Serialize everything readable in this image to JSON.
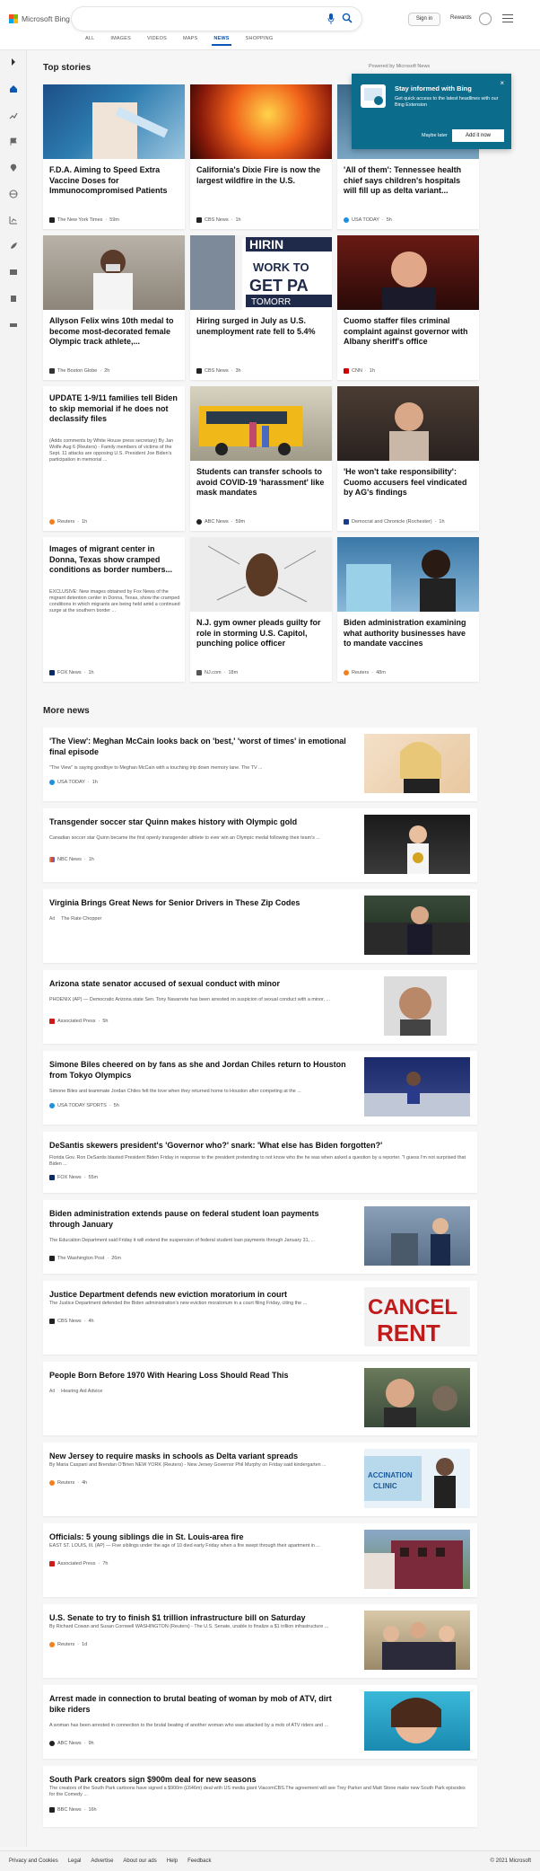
{
  "header": {
    "logo_text": "Microsoft Bing",
    "signin": "Sign in",
    "rewards": "Rewards",
    "tabs": [
      "ALL",
      "IMAGES",
      "VIDEOS",
      "MAPS",
      "NEWS",
      "SHOPPING"
    ],
    "active_tab": "NEWS"
  },
  "top_stories": {
    "title": "Top stories",
    "powered": "Powered by Microsoft News",
    "cards": [
      {
        "title": "F.D.A. Aiming to Speed Extra Vaccine Doses for Immunocompromised Patients",
        "source": "The New York Times",
        "time": "59m"
      },
      {
        "title": "California's Dixie Fire is now the largest wildfire in the U.S.",
        "source": "CBS News",
        "time": "1h"
      },
      {
        "title": "'All of them': Tennessee health chief says children's hospitals will fill up as delta variant...",
        "source": "USA TODAY",
        "time": "5h"
      },
      {
        "title": "Allyson Felix wins 10th medal to become most-decorated female Olympic track athlete,...",
        "source": "The Boston Globe",
        "time": "2h"
      },
      {
        "title": "Hiring surged in July as U.S. unemployment rate fell to 5.4%",
        "source": "CBS News",
        "time": "3h"
      },
      {
        "title": "Cuomo staffer files criminal complaint against governor with Albany sheriff's office",
        "source": "CNN",
        "time": "1h"
      },
      {
        "title": "UPDATE 1-9/11 families tell Biden to skip memorial if he does not declassify files",
        "desc": "(Adds comments by White House press secretary) By Jan Wolfe Aug 6 (Reuters) - Family members of victims of the Sept. 11 attacks are opposing U.S. President Joe Biden's participation in memorial ...",
        "source": "Reuters",
        "time": "1h"
      },
      {
        "title": "Students can transfer schools to avoid COVID-19 'harassment' like mask mandates",
        "source": "ABC News",
        "time": "59m"
      },
      {
        "title": "'He won't take responsibility': Cuomo accusers feel vindicated by AG's findings",
        "source": "Democrat and Chronicle (Rochester)",
        "time": "1h"
      },
      {
        "title": "Images of migrant center in Donna, Texas show cramped conditions as border numbers...",
        "desc": "EXCLUSIVE: New images obtained by Fox News of the migrant detention center in Donna, Texas, show the cramped conditions in which migrants are being held amid a continued surge at the southern border ...",
        "source": "FOX News",
        "time": "1h"
      },
      {
        "title": "N.J. gym owner pleads guilty for role in storming U.S. Capitol, punching police officer",
        "source": "NJ.com",
        "time": "18m"
      },
      {
        "title": "Biden administration examining what authority businesses have to mandate vaccines",
        "source": "Reuters",
        "time": "48m"
      }
    ]
  },
  "popup": {
    "title": "Stay informed with Bing",
    "text": "Get quick access to the latest headlines with our Bing Extension",
    "later": "Maybe later",
    "add": "Add it now",
    "close": "×"
  },
  "more_news": {
    "title": "More news",
    "items": [
      {
        "title": "'The View': Meghan McCain looks back on 'best,' 'worst of times' in emotional final episode",
        "desc": "\"The View\" is saying goodbye to Meghan McCain with a touching trip down memory lane. The TV ...",
        "source": "USA TODAY",
        "time": "1h"
      },
      {
        "title": "Transgender soccer star Quinn makes history with Olympic gold",
        "desc": "Canadian soccer star Quinn became the first openly transgender athlete to ever win an Olympic medal following their team's ...",
        "source": "NBC News",
        "time": "1h"
      },
      {
        "title": "Virginia Brings Great News for Senior Drivers in These Zip Codes",
        "ad": "Ad",
        "source": "The Rate Chopper",
        "time": ""
      },
      {
        "title": "Arizona state senator accused of sexual conduct with minor",
        "desc": "PHOENIX (AP) — Democratic Arizona state Sen. Tony Navarrete has been arrested on suspicion of sexual conduct with a minor, ...",
        "source": "Associated Press",
        "time": "5h"
      },
      {
        "title": "Simone Biles cheered on by fans as she and Jordan Chiles return to Houston from Tokyo Olympics",
        "desc": "Simone Biles and teammate Jordan Chiles felt the love when they returned home to Houston after competing at the ...",
        "source": "USA TODAY SPORTS",
        "time": "5h"
      },
      {
        "title": "DeSantis skewers president's 'Governor who?' snark: 'What else has Biden forgotten?'",
        "desc": "Florida Gov. Ron DeSantis blasted President Biden Friday in response to the president pretending to not know who the he was when asked a question by a reporter. \"I guess I'm not surprised that Biden ...",
        "source": "FOX News",
        "time": "55m"
      },
      {
        "title": "Biden administration extends pause on federal student loan payments through January",
        "desc": "The Education Department said Friday it will extend the suspension of federal student loan payments through January 31, ...",
        "source": "The Washington Post",
        "time": "26m"
      },
      {
        "title": "Justice Department defends new eviction moratorium in court",
        "desc": "The Justice Department defended the Biden administration's new eviction moratorium in a court filing Friday, citing the ...",
        "source": "CBS News",
        "time": "4h"
      },
      {
        "title": "People Born Before 1970 With Hearing Loss Should Read This",
        "ad": "Ad",
        "source": "Hearing Aid Advice",
        "time": ""
      },
      {
        "title": "New Jersey to require masks in schools as Delta variant spreads",
        "desc": "By Maria Caspani and Brendan O'Brien NEW YORK (Reuters) - New Jersey Governor Phil Murphy on Friday said kindergarten ...",
        "source": "Reuters",
        "time": "4h"
      },
      {
        "title": "Officials: 5 young siblings die in St. Louis-area fire",
        "desc": "EAST ST. LOUIS, Ill. (AP) — Five siblings under the age of 10 died early Friday when a fire swept through their apartment in ...",
        "source": "Associated Press",
        "time": "7h"
      },
      {
        "title": "U.S. Senate to try to finish $1 trillion infrastructure bill on Saturday",
        "desc": "By Richard Cowan and Susan Cornwell WASHINGTON (Reuters) - The U.S. Senate, unable to finalize a $1 trillion infrastructure ...",
        "source": "Reuters",
        "time": "1d"
      },
      {
        "title": "Arrest made in connection to brutal beating of woman by mob of ATV, dirt bike riders",
        "desc": "A woman has been arrested in connection to the brutal beating of another woman who was attacked by a mob of ATV riders and ...",
        "source": "ABC News",
        "time": "9h"
      },
      {
        "title": "South Park creators sign $900m deal for new seasons",
        "desc": "The creators of the South Park cartoons have signed a $900m (£646m) deal with US media giant ViacomCBS.The agreement will see Trey Parker and Matt Stone make new South Park episodes for the Comedy ...",
        "source": "BBC News",
        "time": "16h"
      }
    ]
  },
  "footer": {
    "links": [
      "Privacy and Cookies",
      "Legal",
      "Advertise",
      "About our ads",
      "Help",
      "Feedback"
    ],
    "copyright": "© 2021 Microsoft"
  }
}
